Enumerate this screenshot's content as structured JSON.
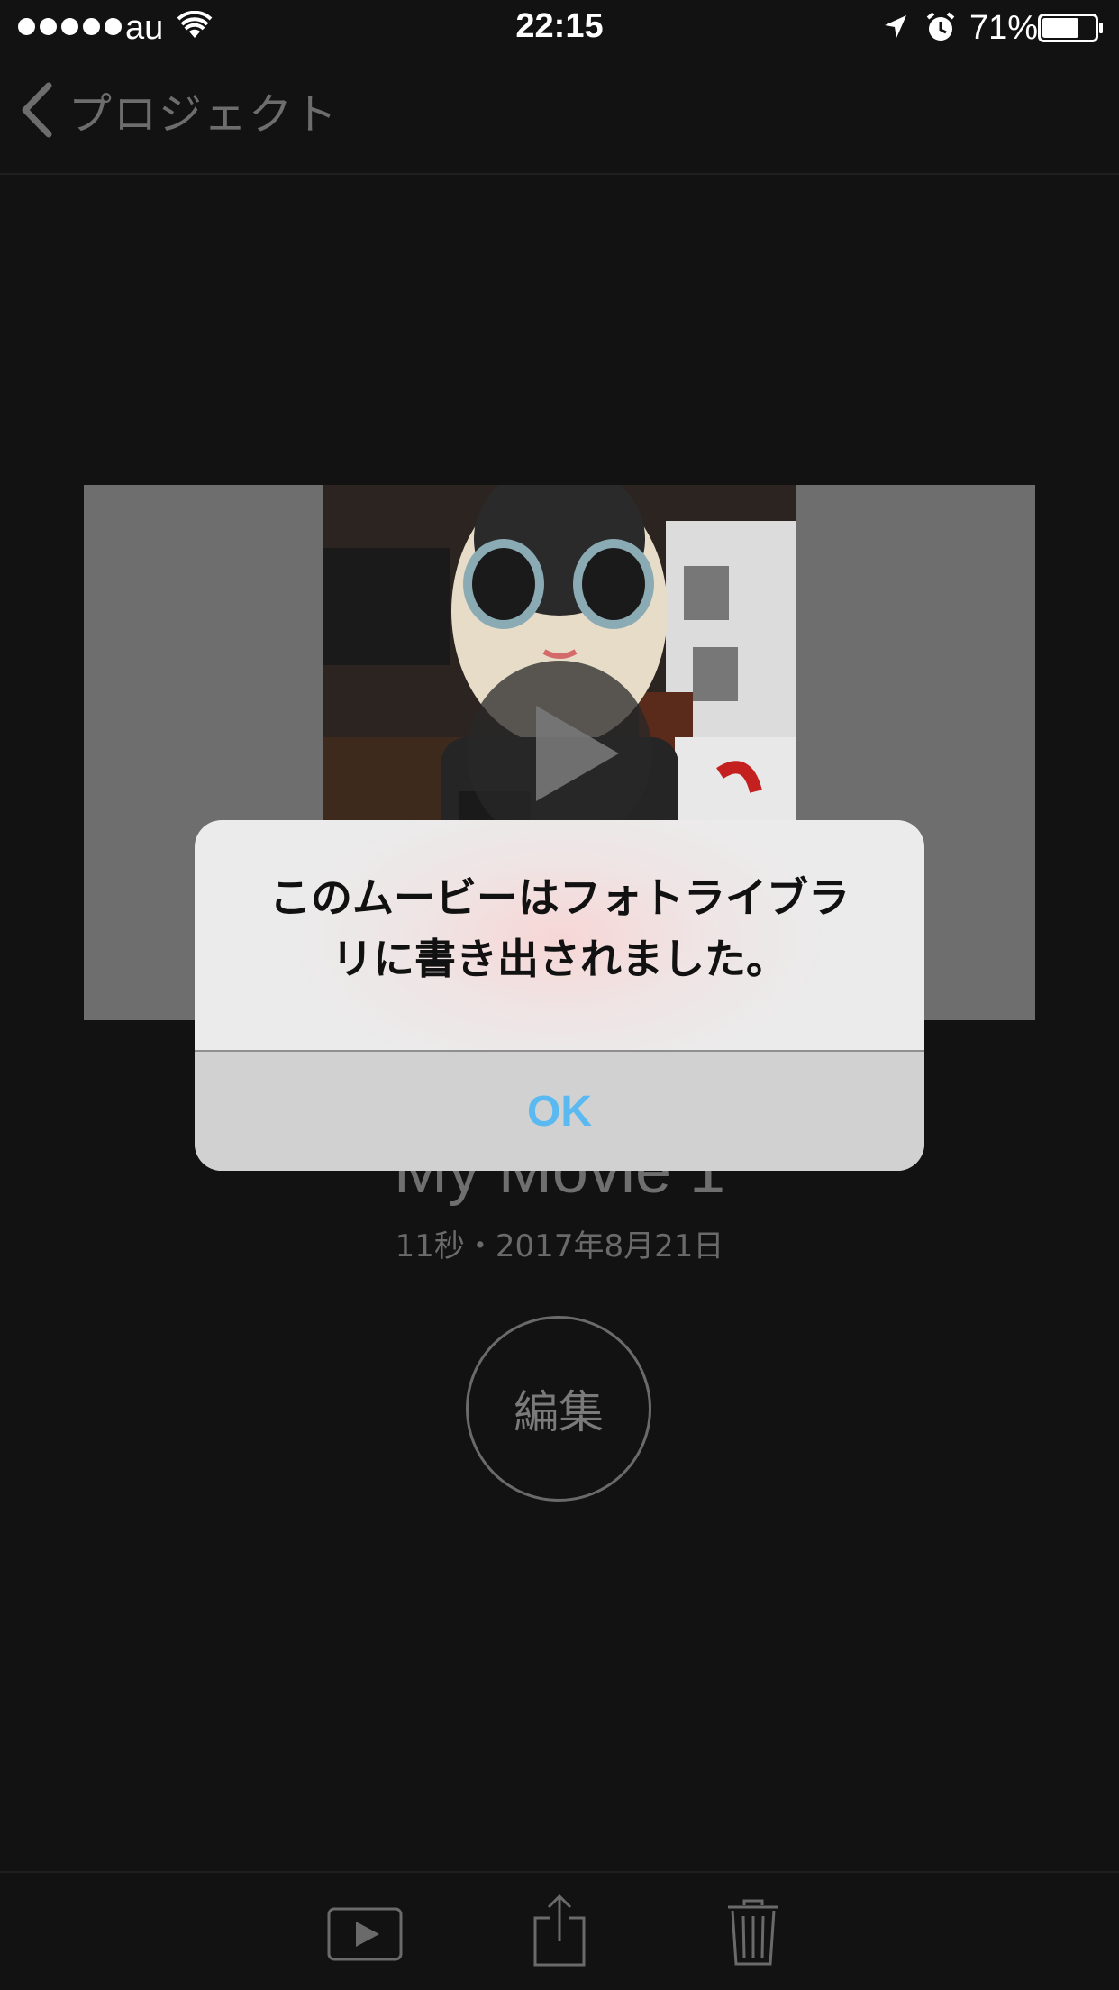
{
  "status_bar": {
    "carrier": "au",
    "time": "22:15",
    "battery_percent": "71%",
    "battery_level": 0.71,
    "signal_bars": 5,
    "icons": [
      "wifi-icon",
      "location-icon",
      "alarm-icon",
      "battery-icon"
    ]
  },
  "nav": {
    "back_label": "プロジェクト",
    "back_icon": "chevron-left-icon"
  },
  "project": {
    "title": "My Movie 1",
    "meta": "11秒・2017年8月21日",
    "edit_label": "編集"
  },
  "toolbar": {
    "items": [
      "play-icon",
      "share-icon",
      "trash-icon"
    ]
  },
  "alert": {
    "message_line1": "このムービーはフォトライブラ",
    "message_line2": "リに書き出されました。",
    "ok_label": "OK"
  },
  "colors": {
    "background": "#121212",
    "ok_blue": "#5ab9f0",
    "muted_text": "#6d6d6d"
  }
}
